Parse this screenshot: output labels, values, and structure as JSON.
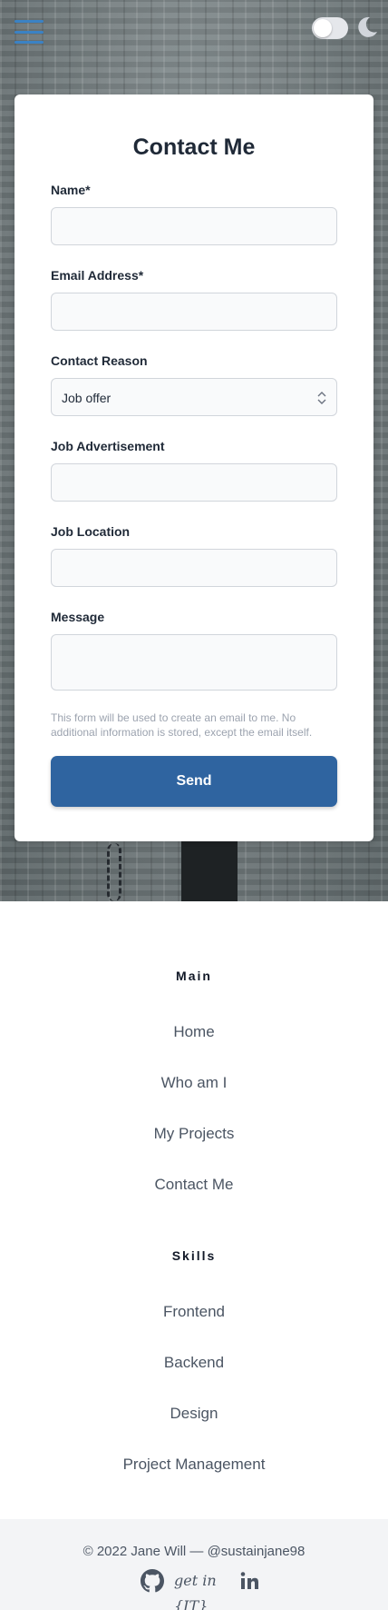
{
  "header": {
    "menu_icon": "hamburger-menu-icon",
    "theme_toggle": {
      "state": "off"
    },
    "theme_icon": "moon-icon",
    "accent_color": "#3b82c4"
  },
  "contact_form": {
    "title": "Contact Me",
    "fields": {
      "name": {
        "label": "Name*",
        "value": ""
      },
      "email": {
        "label": "Email Address*",
        "value": ""
      },
      "reason": {
        "label": "Contact Reason",
        "value": "Job offer"
      },
      "job_ad": {
        "label": "Job Advertisement",
        "value": ""
      },
      "job_location": {
        "label": "Job Location",
        "value": ""
      },
      "message": {
        "label": "Message",
        "value": ""
      }
    },
    "disclaimer": "This form will be used to create an email to me. No additional information is stored, except the email itself.",
    "send_label": "Send",
    "button_color": "#2f64a0"
  },
  "nav": {
    "main_heading": "Main",
    "main_links": [
      "Home",
      "Who am I",
      "My Projects",
      "Contact Me"
    ],
    "skills_heading": "Skills",
    "skills_links": [
      "Frontend",
      "Backend",
      "Design",
      "Project Management"
    ]
  },
  "footer": {
    "copyright": "© 2022 Jane Will — @sustainjane98",
    "getin_logo_text": "get in {IT}",
    "social_icons": [
      "github-icon",
      "getinit-logo-icon",
      "linkedin-icon"
    ]
  }
}
